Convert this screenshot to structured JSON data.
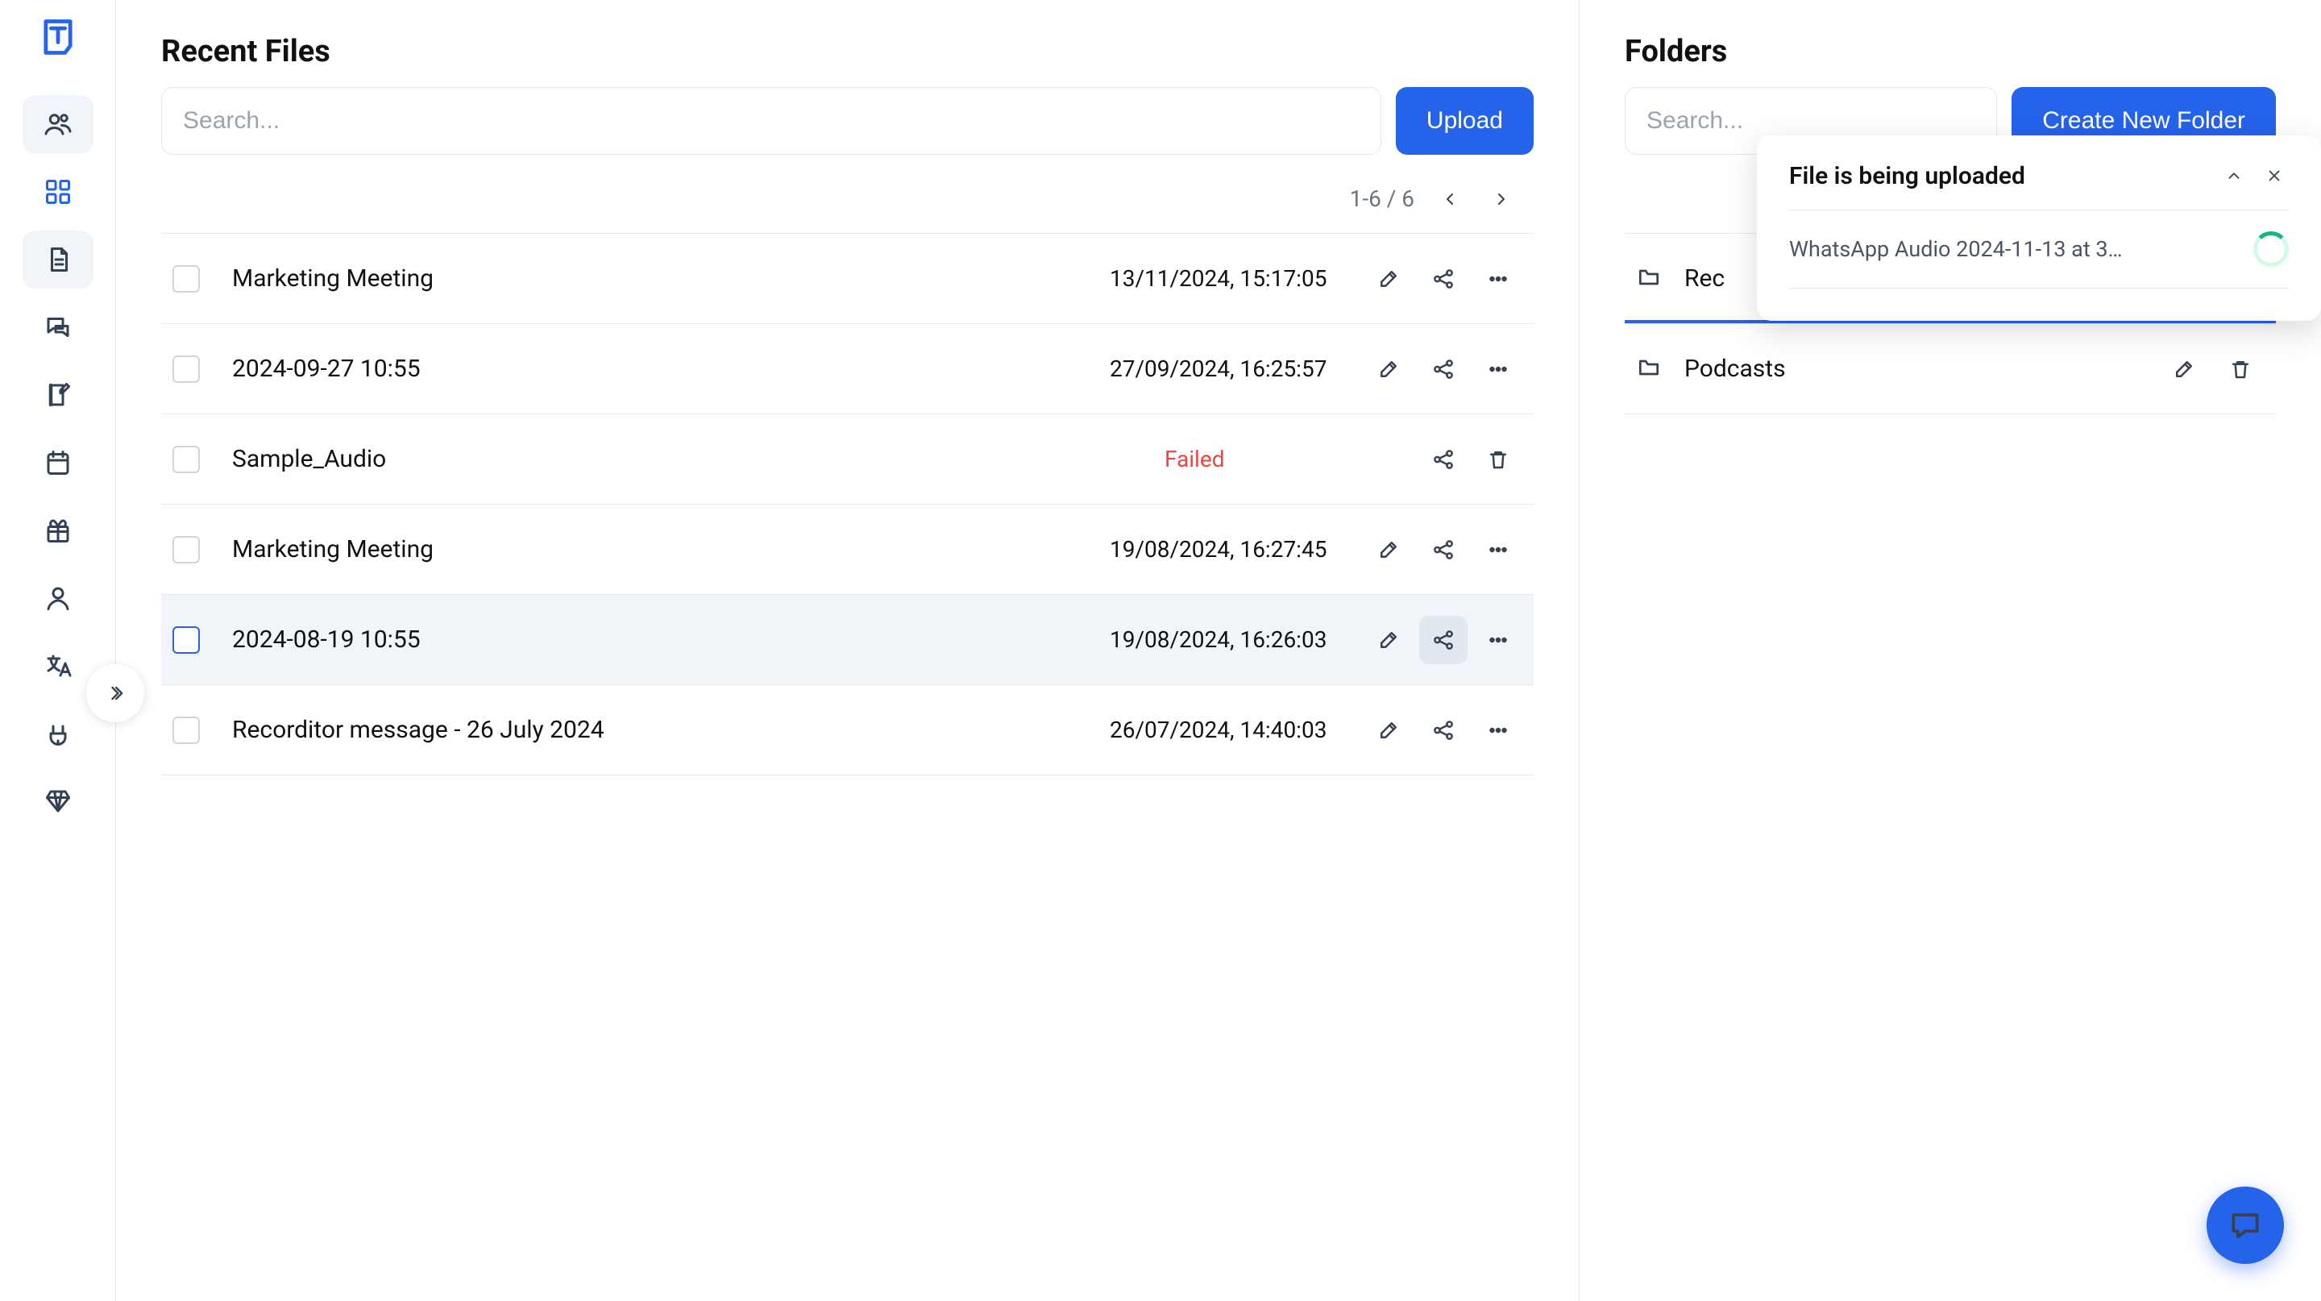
{
  "sidebar": {
    "items": [
      {
        "name": "people-icon"
      },
      {
        "name": "dashboard-icon"
      },
      {
        "name": "file-icon"
      },
      {
        "name": "chat-icon"
      },
      {
        "name": "note-icon"
      },
      {
        "name": "calendar-icon"
      },
      {
        "name": "gift-icon"
      },
      {
        "name": "user-icon"
      },
      {
        "name": "translate-icon"
      },
      {
        "name": "plug-icon"
      },
      {
        "name": "diamond-icon"
      }
    ]
  },
  "files": {
    "title": "Recent Files",
    "search_placeholder": "Search...",
    "upload_label": "Upload",
    "pager": "1-6 / 6",
    "rows": [
      {
        "name": "Marketing Meeting",
        "meta": "13/11/2024, 15:17:05",
        "status": "ok"
      },
      {
        "name": "2024-09-27 10:55",
        "meta": "27/09/2024, 16:25:57",
        "status": "ok"
      },
      {
        "name": "Sample_Audio",
        "meta": "Failed",
        "status": "failed"
      },
      {
        "name": "Marketing Meeting",
        "meta": "19/08/2024, 16:27:45",
        "status": "ok"
      },
      {
        "name": "2024-08-19 10:55",
        "meta": "19/08/2024, 16:26:03",
        "status": "ok",
        "hovered": true
      },
      {
        "name": "Recorditor message - 26 July 2024",
        "meta": "26/07/2024, 14:40:03",
        "status": "ok"
      }
    ]
  },
  "folders": {
    "title": "Folders",
    "search_placeholder": "Search...",
    "create_label": "Create New Folder",
    "rows": [
      {
        "name": "Rec"
      },
      {
        "name": "Podcasts"
      }
    ]
  },
  "toast": {
    "title": "File is being uploaded",
    "file": "WhatsApp Audio 2024-11-13 at 3…"
  }
}
